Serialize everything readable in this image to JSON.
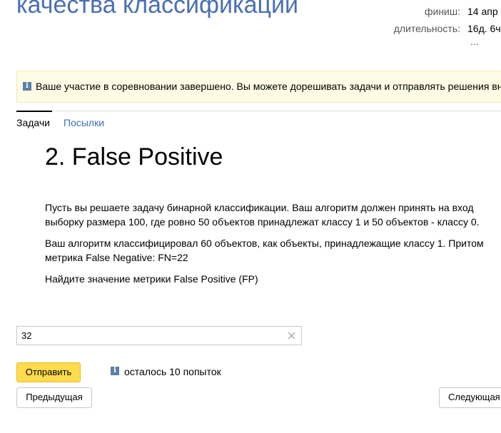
{
  "contest": {
    "title": "качества классификации",
    "finish_label": "финиш:",
    "finish_value": "14 апр",
    "duration_label": "длительность:",
    "duration_value": "16д. 6ч",
    "more": "..."
  },
  "notice": {
    "icon": "info-icon",
    "text": "Ваше участие в соревновании завершено. Вы можете дорешивать задачи и отправлять решения вне"
  },
  "tabs": [
    {
      "label": "Задачи",
      "active": true
    },
    {
      "label": "Посылки",
      "active": false
    }
  ],
  "problem": {
    "title": "2. False Positive",
    "paragraphs": [
      "Пусть вы решаете задачу бинарной классификации. Ваш алгоритм должен принять на вход выборку размера 100, где ровно 50 объектов принадлежат классу 1 и 50 объектов - классу 0.",
      "Ваш алгоритм классифицировал 60 объектов, как объекты, принадлежащие классу 1. Притом метрика False Negative: FN=22",
      "Найдите значение метрики False Positive (FP)"
    ]
  },
  "answer": {
    "value": "32",
    "clear_icon": "close-icon"
  },
  "actions": {
    "submit_label": "Отправить",
    "attempts_icon": "info-icon",
    "attempts_text": "осталось 10 попыток",
    "prev_label": "Предыдущая",
    "next_label": "Следующая"
  },
  "colors": {
    "accent_link": "#3f6fb8",
    "title_blue": "#4a6fb3",
    "submit_yellow": "#ffdb4d",
    "notice_bg": "#fffbe5",
    "info_icon": "#5b7fa6"
  }
}
